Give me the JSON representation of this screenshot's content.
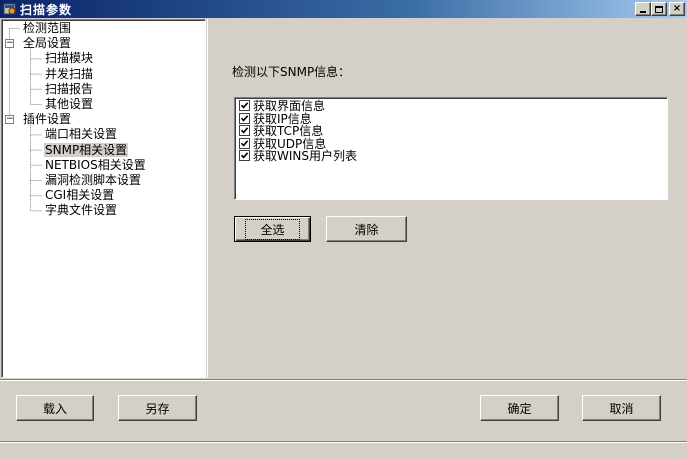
{
  "window": {
    "title": "扫描参数",
    "icon": "app-window-icon",
    "minimize_label": "",
    "maximize_label": "",
    "close_label": "×"
  },
  "tree": {
    "items": [
      {
        "label": "检测范围",
        "level": 1,
        "selected": false
      },
      {
        "label": "全局设置",
        "level": 0,
        "expander": "−"
      },
      {
        "label": "扫描模块",
        "level": 2,
        "selected": false
      },
      {
        "label": "并发扫描",
        "level": 2,
        "selected": false
      },
      {
        "label": "扫描报告",
        "level": 2,
        "selected": false
      },
      {
        "label": "其他设置",
        "level": 2,
        "selected": false
      },
      {
        "label": "插件设置",
        "level": 0,
        "expander": "−"
      },
      {
        "label": "端口相关设置",
        "level": 2,
        "selected": false
      },
      {
        "label": "SNMP相关设置",
        "level": 2,
        "selected": true
      },
      {
        "label": "NETBIOS相关设置",
        "level": 2,
        "selected": false
      },
      {
        "label": "漏洞检测脚本设置",
        "level": 2,
        "selected": false
      },
      {
        "label": "CGI相关设置",
        "level": 2,
        "selected": false
      },
      {
        "label": "字典文件设置",
        "level": 2,
        "selected": false
      }
    ]
  },
  "snmp": {
    "section_label": "检测以下SNMP信息：",
    "options": [
      {
        "label": "获取界面信息",
        "checked": true
      },
      {
        "label": "获取IP信息",
        "checked": true
      },
      {
        "label": "获取TCP信息",
        "checked": true
      },
      {
        "label": "获取UDP信息",
        "checked": true
      },
      {
        "label": "获取WINS用户列表",
        "checked": true
      }
    ],
    "select_all_label": "全选",
    "clear_label": "清除"
  },
  "footer": {
    "load_label": "载入",
    "save_as_label": "另存",
    "ok_label": "确定",
    "cancel_label": "取消"
  },
  "colors": {
    "titlebar_start": "#0a246a",
    "titlebar_end": "#a6caf0",
    "face": "#d4d0c8"
  }
}
